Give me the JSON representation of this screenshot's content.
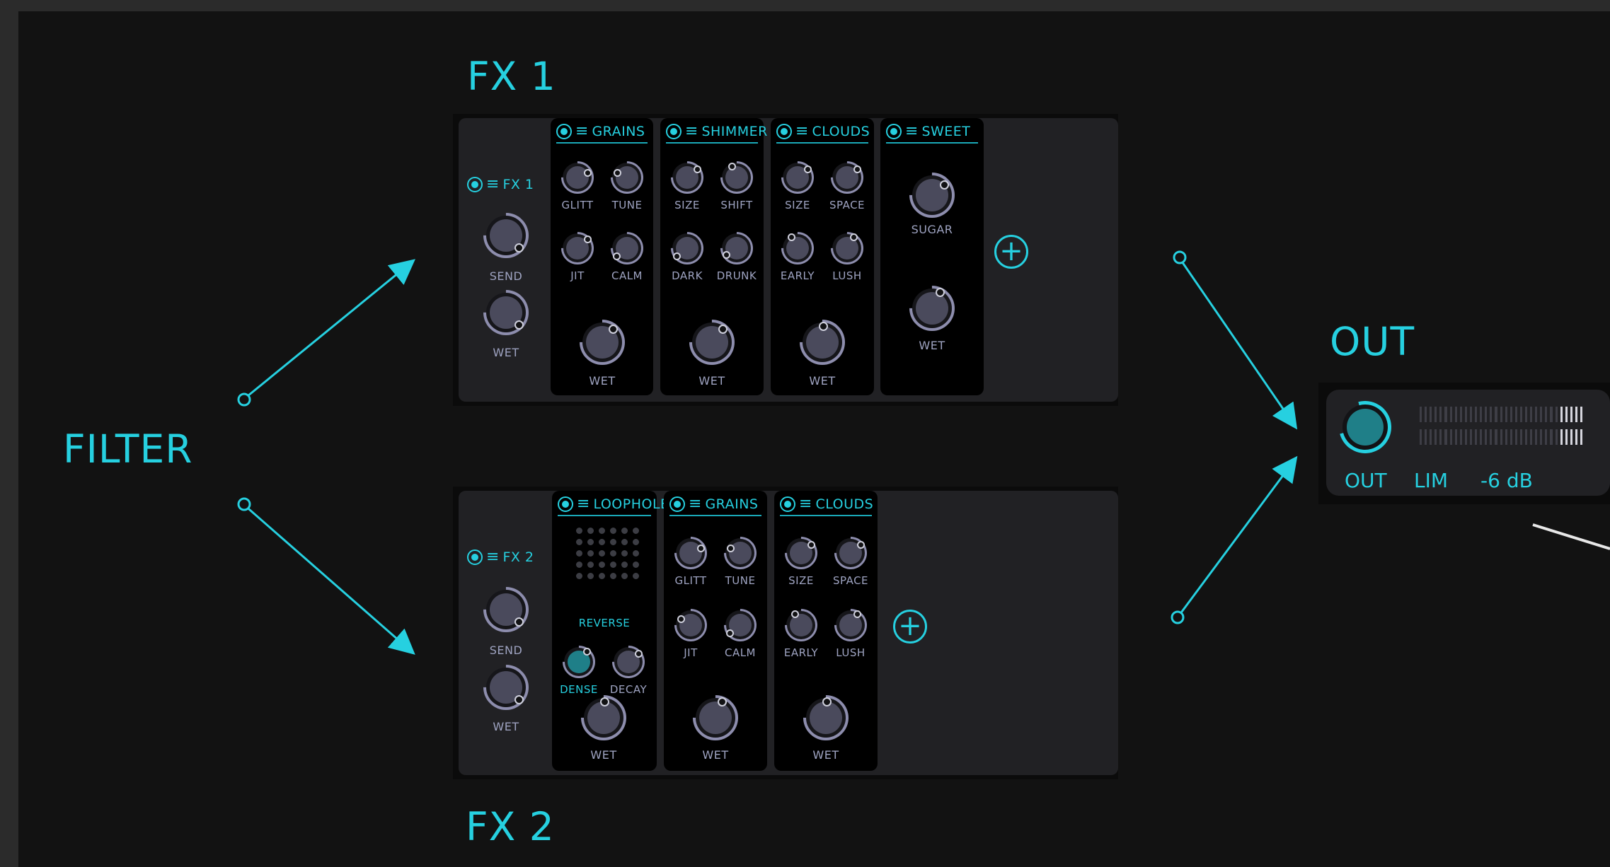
{
  "labels": {
    "filter": "FILTER",
    "fx1": "FX 1",
    "fx2": "FX 2",
    "out": "OUT"
  },
  "icons": {
    "power": "power-icon",
    "menu": "menu-icon",
    "add": "plus-icon"
  },
  "colors": {
    "accent": "#26d0e0",
    "panel": "#212124",
    "knob": "#4a4a5c"
  },
  "fx1": {
    "strip": {
      "title": "FX 1",
      "send": "SEND",
      "wet": "WET"
    },
    "modules": [
      {
        "name": "GRAINS",
        "k1": "GLITT",
        "k2": "TUNE",
        "k3": "JIT",
        "k4": "CALM",
        "wet": "WET"
      },
      {
        "name": "SHIMMER",
        "k1": "SIZE",
        "k2": "SHIFT",
        "k3": "DARK",
        "k4": "DRUNK",
        "wet": "WET"
      },
      {
        "name": "CLOUDS",
        "k1": "SIZE",
        "k2": "SPACE",
        "k3": "EARLY",
        "k4": "LUSH",
        "wet": "WET"
      },
      {
        "name": "SWEET",
        "k1": "SUGAR",
        "wet": "WET"
      }
    ],
    "add": "+"
  },
  "fx2": {
    "strip": {
      "title": "FX 2",
      "send": "SEND",
      "wet": "WET"
    },
    "modules": [
      {
        "name": "LOOPHOLE",
        "k1": "REVERSE",
        "k2": "DENSE",
        "k3": "DECAY",
        "wet": "WET"
      },
      {
        "name": "GRAINS",
        "k1": "GLITT",
        "k2": "TUNE",
        "k3": "JIT",
        "k4": "CALM",
        "wet": "WET"
      },
      {
        "name": "CLOUDS",
        "k1": "SIZE",
        "k2": "SPACE",
        "k3": "EARLY",
        "k4": "LUSH",
        "wet": "WET"
      }
    ],
    "add": "+"
  },
  "output": {
    "knob": "OUT",
    "limiter": "LIM",
    "gain": "-6 dB"
  }
}
